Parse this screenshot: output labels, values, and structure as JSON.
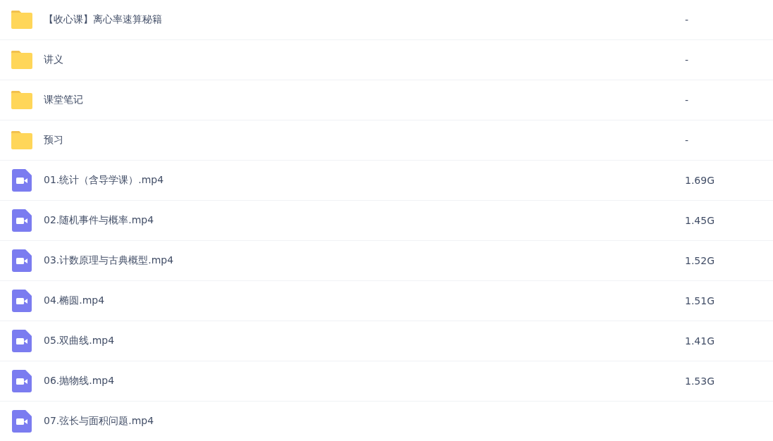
{
  "files": [
    {
      "kind": "folder",
      "name": "【收心课】离心率速算秘籍",
      "size": "-"
    },
    {
      "kind": "folder",
      "name": "讲义",
      "size": "-"
    },
    {
      "kind": "folder",
      "name": "课堂笔记",
      "size": "-"
    },
    {
      "kind": "folder",
      "name": "预习",
      "size": "-"
    },
    {
      "kind": "video",
      "name": "01.统计（含导学课）.mp4",
      "size": "1.69G"
    },
    {
      "kind": "video",
      "name": "02.随机事件与概率.mp4",
      "size": "1.45G"
    },
    {
      "kind": "video",
      "name": "03.计数原理与古典概型.mp4",
      "size": "1.52G"
    },
    {
      "kind": "video",
      "name": "04.椭圆.mp4",
      "size": "1.51G"
    },
    {
      "kind": "video",
      "name": "05.双曲线.mp4",
      "size": "1.41G"
    },
    {
      "kind": "video",
      "name": "06.抛物线.mp4",
      "size": "1.53G"
    },
    {
      "kind": "video",
      "name": "07.弦长与面积问题.mp4"
    }
  ]
}
